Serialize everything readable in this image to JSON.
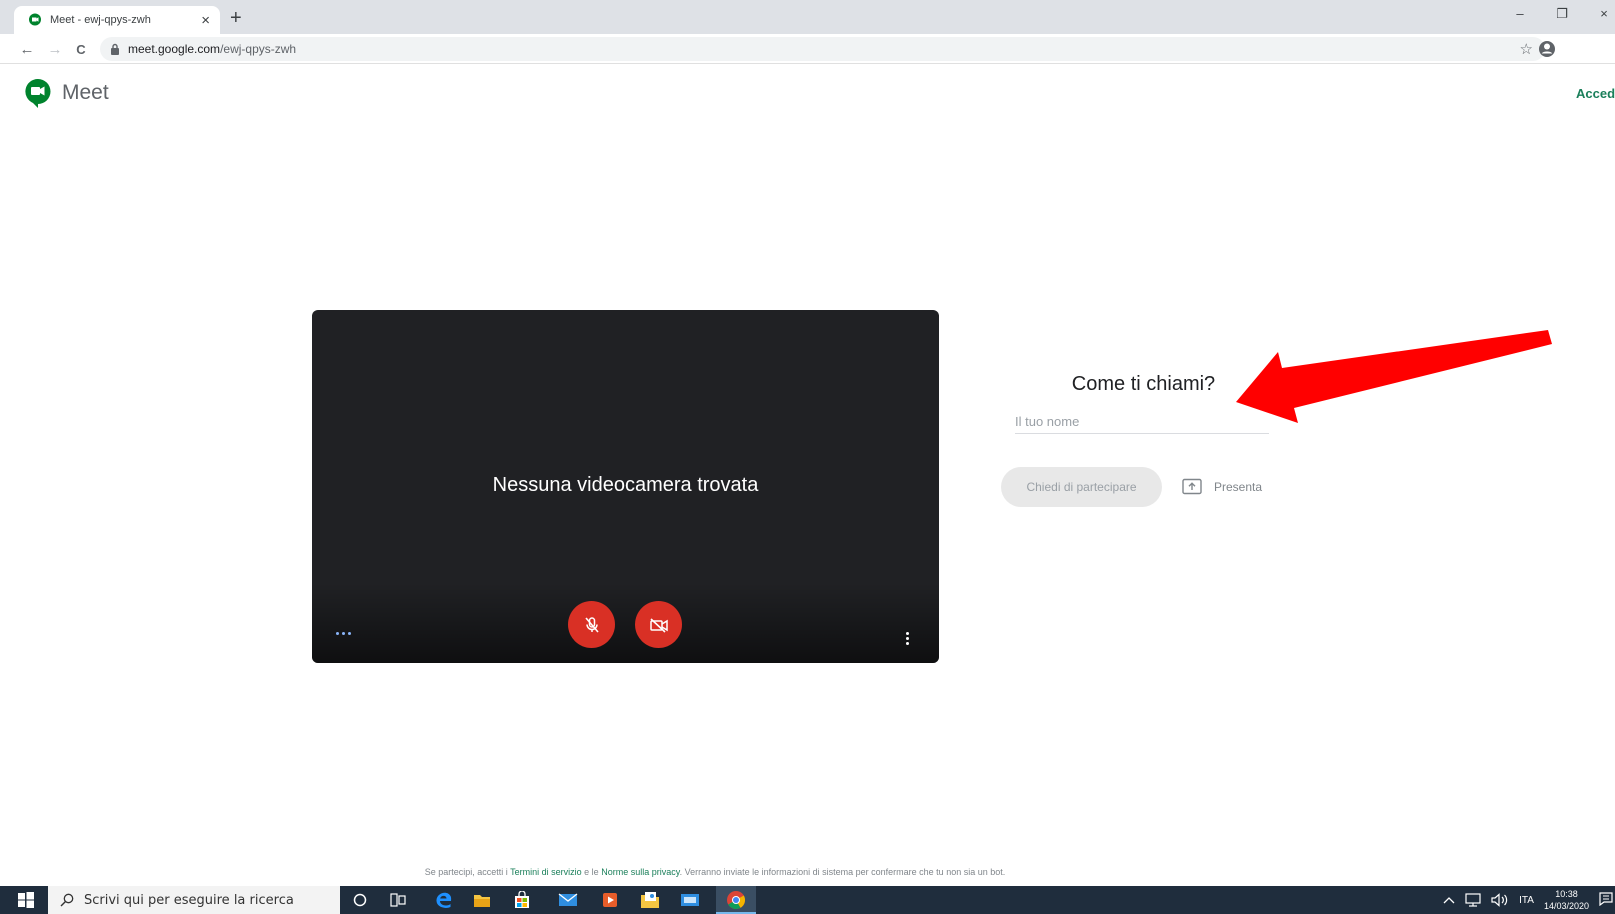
{
  "browser": {
    "tab_title": "Meet - ewj-qpys-zwh",
    "tab_close": "×",
    "new_tab": "+",
    "url_host": "meet.google.com",
    "url_path": "/ewj-qpys-zwh",
    "back": "←",
    "forward": "→",
    "reload": "C",
    "bookmark_star": "☆",
    "window_minimize": "–",
    "window_restore": "❐",
    "window_close": "×"
  },
  "header": {
    "brand": "Meet",
    "signin_label": "Accedi"
  },
  "preview": {
    "no_camera_text": "Nessuna videocamera trovata"
  },
  "join": {
    "title": "Come ti chiami?",
    "name_placeholder": "Il tuo nome",
    "name_value": "",
    "join_button": "Chiedi di partecipare",
    "present_label": "Presenta"
  },
  "footer": {
    "prefix": "Se partecipi, accetti i",
    "terms_link": "Termini di servizio",
    "middle": "e le",
    "privacy_link": "Norme sulla privacy",
    "suffix": ". Verranno inviate le informazioni di sistema per confermare che tu non sia un bot."
  },
  "taskbar": {
    "search_placeholder": "Scrivi qui per eseguire la ricerca",
    "language": "ITA",
    "time": "10:38",
    "date": "14/03/2020"
  },
  "colors": {
    "accent_green": "#1a7f5a",
    "meet_logo_green": "#00832d",
    "mute_red": "#d93025",
    "annotation_arrow_red": "#ff0000",
    "preview_bg": "#202124"
  }
}
